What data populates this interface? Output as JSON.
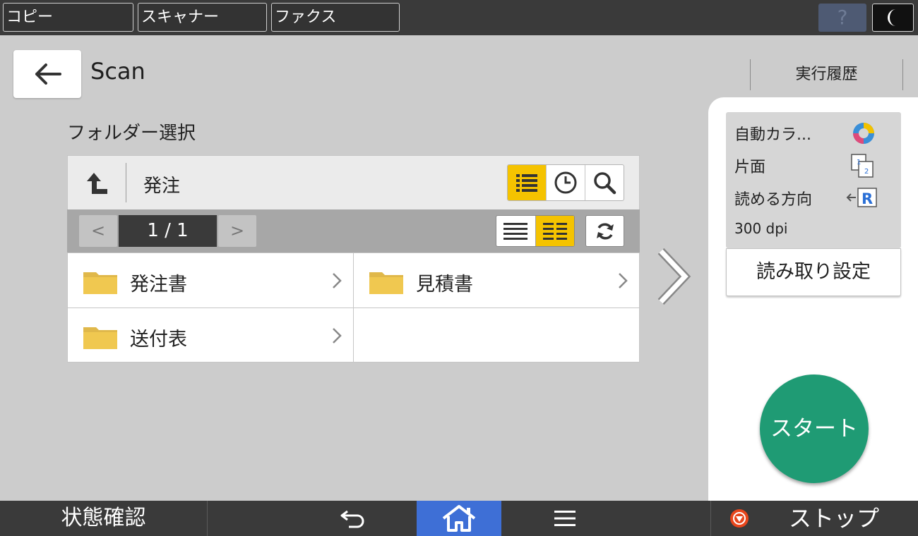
{
  "top_tabs": [
    {
      "label": "コピー"
    },
    {
      "label": "スキャナー"
    },
    {
      "label": "ファクス"
    }
  ],
  "top_right": {
    "help_label": "?"
  },
  "header": {
    "title": "Scan",
    "history_label": "実行履歴"
  },
  "folder_select": {
    "section_label": "フォルダー選択",
    "current_path": "発注",
    "pager": {
      "prev": "<",
      "display": "1 / 1",
      "next": ">"
    },
    "folders": [
      {
        "name": "発注書"
      },
      {
        "name": "見積書"
      },
      {
        "name": "送付表"
      }
    ]
  },
  "scan_settings": {
    "color_mode": "自動カラ...",
    "sides": "片面",
    "orientation": "読める方向",
    "resolution": "300 dpi",
    "button_label": "読み取り設定",
    "duplex_icon_digits": [
      "1",
      "2"
    ],
    "orientation_icon_letter": "R"
  },
  "start_button": {
    "label": "スタート",
    "color": "#1f9b74"
  },
  "bottom_bar": {
    "status_label": "状態確認",
    "stop_label": "ストップ"
  },
  "colors": {
    "accent_yellow": "#f5c300",
    "home_blue": "#3e6fd6",
    "stop_orange": "#e8461c"
  }
}
